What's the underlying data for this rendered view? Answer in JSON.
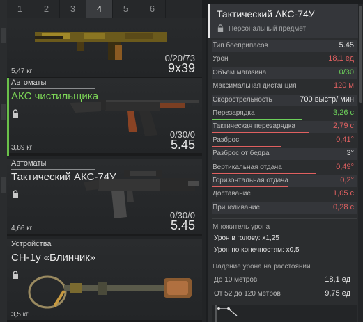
{
  "tabs": [
    "1",
    "2",
    "3",
    "4",
    "5",
    "6"
  ],
  "active_tab_index": 3,
  "cards": [
    {
      "category": "",
      "name": "",
      "weight": "5,47 кг",
      "ammo": "0/20/73",
      "caliber": "9х39",
      "name_color": "#e8e8e8"
    },
    {
      "category": "Автоматы",
      "name": "АКС чистильщика",
      "weight": "3,89 кг",
      "ammo": "0/30/0",
      "caliber": "5.45",
      "name_color": "#7ed957"
    },
    {
      "category": "Автоматы",
      "name": "Тактический АКС-74У",
      "weight": "4,66 кг",
      "ammo": "0/30/0",
      "caliber": "5.45",
      "name_color": "#e8e8e8"
    },
    {
      "category": "Устройства",
      "name": "СН-1у «Блинчик»",
      "weight": "3,5 кг",
      "ammo": "",
      "caliber": "",
      "name_color": "#e8e8e8"
    }
  ],
  "panel": {
    "title": "Тактический АКС-74У",
    "subtitle": "Персональный предмет"
  },
  "stats": [
    {
      "label": "Тип боеприпасов",
      "value": "5.45",
      "tone": "neutral"
    },
    {
      "label": "Урон",
      "value": "18,1 ед",
      "tone": "red"
    },
    {
      "label": "Объем магазина",
      "value": "0/30",
      "tone": "green"
    },
    {
      "label": "Максимальная дистанция",
      "value": "120 м",
      "tone": "red"
    },
    {
      "label": "Скорострельность",
      "value": "700 выстр/ мин",
      "tone": "neutral"
    },
    {
      "label": "Перезарядка",
      "value": "3,26 с",
      "tone": "green"
    },
    {
      "label": "Тактическая перезарядка",
      "value": "2,79 с",
      "tone": "red"
    },
    {
      "label": "Разброс",
      "value": "0,41°",
      "tone": "red"
    },
    {
      "label": "Разброс от бедра",
      "value": "3°",
      "tone": "neutral"
    },
    {
      "label": "Вертикальная отдача",
      "value": "0,49°",
      "tone": "red"
    },
    {
      "label": "Горизонтальная отдача",
      "value": "0,2°",
      "tone": "red"
    },
    {
      "label": "Доставание",
      "value": "1,05 с",
      "tone": "red"
    },
    {
      "label": "Прицеливание",
      "value": "0,28 с",
      "tone": "red"
    }
  ],
  "damage_multiplier": {
    "title": "Множитель урона",
    "head": "Урон в голову: x1,25",
    "limbs": "Урон по конечностям: x0,5"
  },
  "damage_falloff": {
    "title": "Падение урона на расстоянии",
    "rows": [
      {
        "label": "До 10 метров",
        "value": "18,1 ед"
      },
      {
        "label": "От 52 до 120 метров",
        "value": "9,75 ед"
      }
    ]
  },
  "colors": {
    "red": "#e06060",
    "green": "#6ccf5a",
    "accent_bar": "#e6e6e6"
  },
  "icons": [
    "lock-icon"
  ]
}
